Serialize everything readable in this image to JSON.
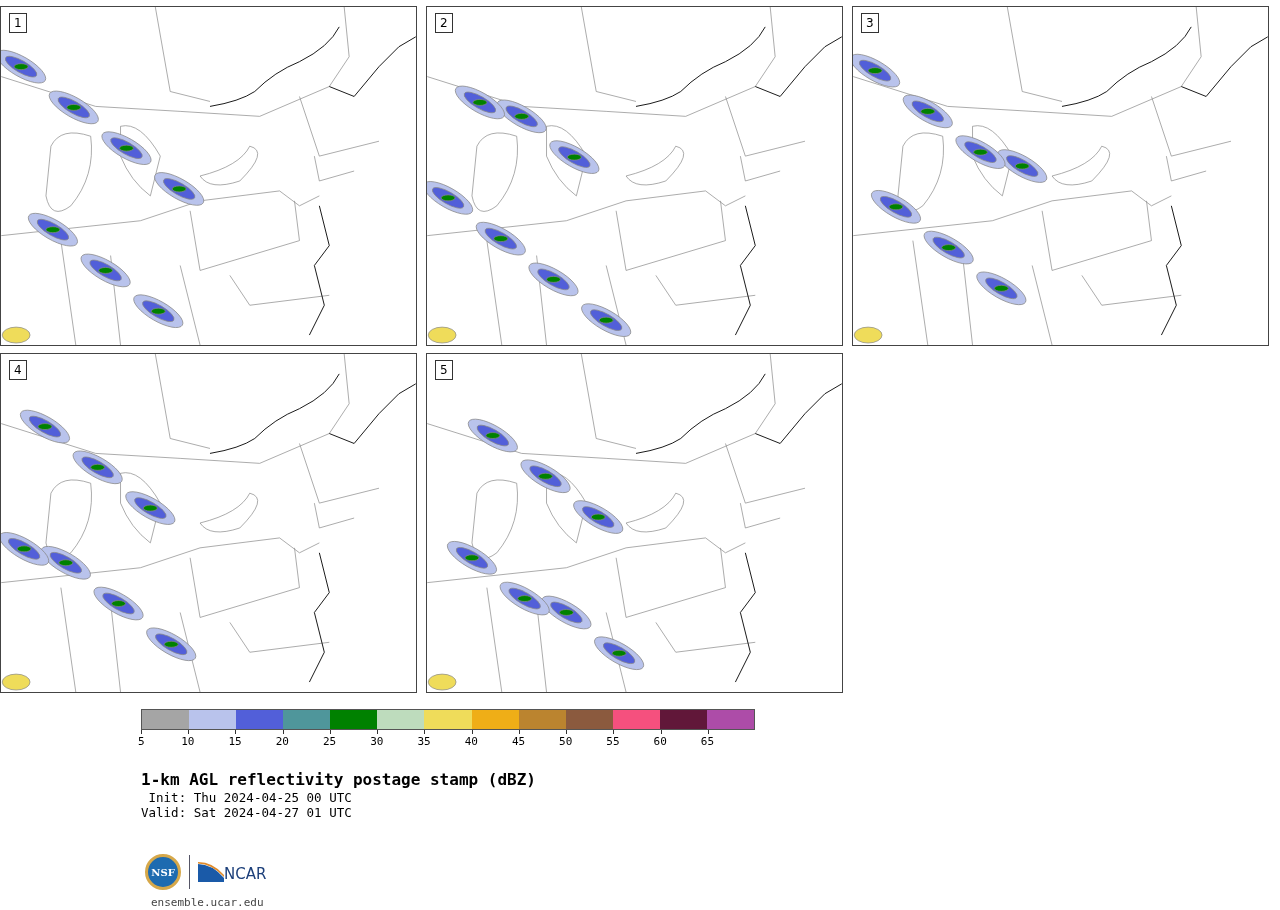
{
  "panels": [
    {
      "label": "1"
    },
    {
      "label": "2"
    },
    {
      "label": "3"
    },
    {
      "label": "4"
    },
    {
      "label": "5"
    }
  ],
  "colorbar": {
    "bins": [
      {
        "label": "5",
        "color": "#a5a5a5"
      },
      {
        "label": "10",
        "color": "#b9c3ec"
      },
      {
        "label": "15",
        "color": "#525fd9"
      },
      {
        "label": "20",
        "color": "#4f969b"
      },
      {
        "label": "25",
        "color": "#008100"
      },
      {
        "label": "30",
        "color": "#bedcbd"
      },
      {
        "label": "35",
        "color": "#efdc5a"
      },
      {
        "label": "40",
        "color": "#efae17"
      },
      {
        "label": "45",
        "color": "#bb842f"
      },
      {
        "label": "50",
        "color": "#8b5a3e"
      },
      {
        "label": "55",
        "color": "#f5507e"
      },
      {
        "label": "60",
        "color": "#611739"
      },
      {
        "label": "65",
        "color": "#ad4ca8"
      }
    ]
  },
  "title": "1-km AGL reflectivity postage stamp (dBZ)",
  "init": " Init: Thu 2024-04-25 00 UTC",
  "valid": "Valid: Sat 2024-04-27 01 UTC",
  "logo": {
    "seal_text": "NSF",
    "wordmark": "NCAR"
  },
  "site": "ensemble.ucar.edu"
}
